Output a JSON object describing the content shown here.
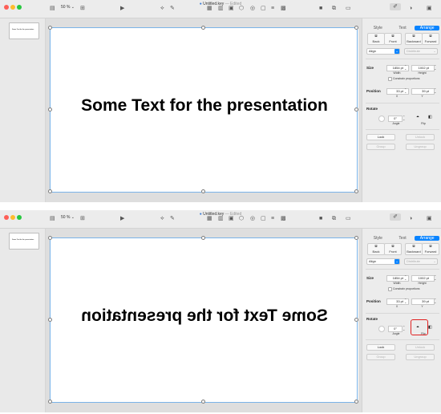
{
  "windows": [
    {
      "id": "before",
      "title_dot": "●",
      "title": "Untitled.key",
      "title_suffix": "— Edited",
      "zoom": "50 % ⌄",
      "thumb_text": "Some Text for the presentation",
      "slide_text": "Some Text for the presentation",
      "mirrored": false,
      "flip_highlighted": false
    },
    {
      "id": "after",
      "title_dot": "●",
      "title": "Untitled.key",
      "title_suffix": "— Edited",
      "zoom": "50 % ⌄",
      "thumb_text": "Some Text for the presentation",
      "slide_text": "Some Text for the presentation",
      "mirrored": true,
      "flip_highlighted": true
    }
  ],
  "inspector": {
    "tabs": [
      "Style",
      "Text",
      "Arrange"
    ],
    "active_tab": "Arrange",
    "order_buttons": [
      "Back",
      "Front",
      "Backward",
      "Forward"
    ],
    "align_label": "Align",
    "distribute_label": "Distribute",
    "size_label": "Size",
    "width_value": "1854 pt",
    "height_value": "1002 pt",
    "width_label": "Width",
    "height_label": "Height",
    "constrain_label": "Constrain proportions",
    "position_label": "Position",
    "x_value": "33 pt",
    "y_value": "39 pt",
    "x_label": "X",
    "y_label": "Y",
    "rotate_label": "Rotate",
    "angle_value": "0°",
    "angle_label": "Angle",
    "flip_label": "Flip",
    "lock_label": "Lock",
    "unlock_label": "Unlock",
    "group_label": "Group",
    "ungroup_label": "Ungroup"
  },
  "colors": {
    "accent": "#0a84ff",
    "highlight": "#e02020"
  }
}
